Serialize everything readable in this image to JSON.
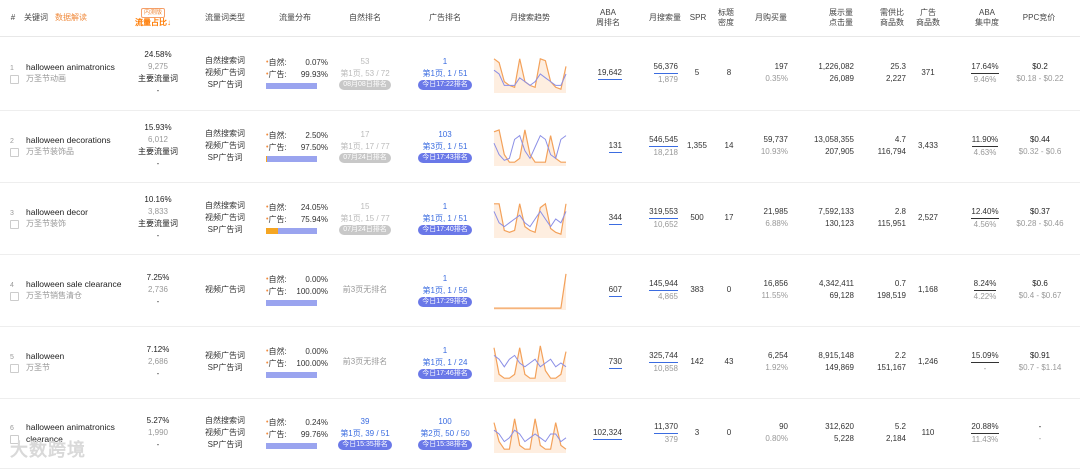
{
  "header": {
    "num": "#",
    "keyword": "关键词",
    "data_export": "数据解读",
    "badge_new": "内测版",
    "flow_share": "流量占比",
    "flow_type": "流量词类型",
    "flow_dist": "流量分布",
    "natural_rank": "自然排名",
    "ad_rank": "广告排名",
    "trend": "月搜索趋势",
    "aba": "ABA\n周排名",
    "monthly_search": "月搜索量",
    "spr": "SPR",
    "title_density": "标题\n密度",
    "monthly_buy": "月购买量",
    "impressions": "展示量\n点击量",
    "supply_demand": "需供比\n商品数",
    "ad_products": "广告\n商品数",
    "aba_concentration": "ABA\n集中度",
    "ppc": "PPC竞价"
  },
  "rows": [
    {
      "idx": "1",
      "kw": "halloween animatronics",
      "kw_cn": "万圣节动画",
      "share": "24.58%",
      "share_sub": "9,275",
      "share_tag": "主要流量词",
      "share_dash": "-",
      "types": [
        "自然搜索词",
        "视频广告词",
        "SP广告词"
      ],
      "nat_label": "自然:",
      "nat_pct": "0.07%",
      "ad_label": "广告:",
      "ad_pct": "99.93%",
      "nat_frac": 0.0007,
      "nat_rank_top": "53",
      "nat_rank_mid": "第1页, 53 / 72",
      "nat_rank_badge": "08月08日排名",
      "ad_rank_top": "1",
      "ad_rank_mid": "第1页, 1 / 51",
      "ad_rank_badge": "今日17:22排名",
      "aba": "19,642",
      "ms": "56,376",
      "ms_sub": "1,879",
      "spr": "5",
      "td": "8",
      "buy": "197",
      "buy_sub": "0.35%",
      "imp": "1,226,082",
      "clk": "26,089",
      "sd": "25.3",
      "prod": "2,227",
      "adp": "371",
      "conc": "17.64%",
      "conc_sub": "9.46%",
      "ppc": "$0.2",
      "ppc_sub": "$0.18 - $0.22"
    },
    {
      "idx": "2",
      "kw": "halloween decorations",
      "kw_cn": "万圣节装饰品",
      "share": "15.93%",
      "share_sub": "6,012",
      "share_tag": "主要流量词",
      "share_dash": "-",
      "types": [
        "自然搜索词",
        "视频广告词",
        "SP广告词"
      ],
      "nat_label": "自然:",
      "nat_pct": "2.50%",
      "ad_label": "广告:",
      "ad_pct": "97.50%",
      "nat_frac": 0.025,
      "nat_rank_top": "17",
      "nat_rank_mid": "第1页, 17 / 77",
      "nat_rank_badge": "07月24日排名",
      "ad_rank_top": "103",
      "ad_rank_mid": "第3页, 1 / 51",
      "ad_rank_badge": "今日17:43排名",
      "aba": "131",
      "ms": "546,545",
      "ms_sub": "18,218",
      "spr": "1,355",
      "td": "14",
      "buy": "59,737",
      "buy_sub": "10.93%",
      "imp": "13,058,355",
      "clk": "207,905",
      "sd": "4.7",
      "prod": "116,794",
      "adp": "3,433",
      "conc": "11.90%",
      "conc_sub": "4.63%",
      "ppc": "$0.44",
      "ppc_sub": "$0.32 - $0.6"
    },
    {
      "idx": "3",
      "kw": "halloween decor",
      "kw_cn": "万圣节装饰",
      "share": "10.16%",
      "share_sub": "3,833",
      "share_tag": "主要流量词",
      "share_dash": "-",
      "types": [
        "自然搜索词",
        "视频广告词",
        "SP广告词"
      ],
      "nat_label": "自然:",
      "nat_pct": "24.05%",
      "ad_label": "广告:",
      "ad_pct": "75.94%",
      "nat_frac": 0.2405,
      "nat_rank_top": "15",
      "nat_rank_mid": "第1页, 15 / 77",
      "nat_rank_badge": "07月24日排名",
      "ad_rank_top": "1",
      "ad_rank_mid": "第1页, 1 / 51",
      "ad_rank_badge": "今日17:40排名",
      "aba": "344",
      "ms": "319,553",
      "ms_sub": "10,652",
      "spr": "500",
      "td": "17",
      "buy": "21,985",
      "buy_sub": "6.88%",
      "imp": "7,592,133",
      "clk": "130,123",
      "sd": "2.8",
      "prod": "115,951",
      "adp": "2,527",
      "conc": "12.40%",
      "conc_sub": "4.56%",
      "ppc": "$0.37",
      "ppc_sub": "$0.28 - $0.46"
    },
    {
      "idx": "4",
      "kw": "halloween sale clearance",
      "kw_cn": "万圣节销售清仓",
      "share": "7.25%",
      "share_sub": "2,736",
      "share_tag": "",
      "share_dash": "-",
      "types": [
        "视频广告词"
      ],
      "nat_label": "自然:",
      "nat_pct": "0.00%",
      "ad_label": "广告:",
      "ad_pct": "100.00%",
      "nat_frac": 0.0,
      "nat_rank_none": "前3页无排名",
      "ad_rank_top": "1",
      "ad_rank_mid": "第1页, 1 / 56",
      "ad_rank_badge": "今日17:29排名",
      "aba": "607",
      "ms": "145,944",
      "ms_sub": "4,865",
      "spr": "383",
      "td": "0",
      "buy": "16,856",
      "buy_sub": "11.55%",
      "imp": "4,342,411",
      "clk": "69,128",
      "sd": "0.7",
      "prod": "198,519",
      "adp": "1,168",
      "conc": "8.24%",
      "conc_sub": "4.22%",
      "ppc": "$0.6",
      "ppc_sub": "$0.4 - $0.67"
    },
    {
      "idx": "5",
      "kw": "halloween",
      "kw_cn": "万圣节",
      "share": "7.12%",
      "share_sub": "2,686",
      "share_tag": "",
      "share_dash": "-",
      "types": [
        "视频广告词",
        "SP广告词"
      ],
      "nat_label": "自然:",
      "nat_pct": "0.00%",
      "ad_label": "广告:",
      "ad_pct": "100.00%",
      "nat_frac": 0.0,
      "nat_rank_none": "前3页无排名",
      "ad_rank_top": "1",
      "ad_rank_mid": "第1页, 1 / 24",
      "ad_rank_badge": "今日17:46排名",
      "aba": "730",
      "ms": "325,744",
      "ms_sub": "10,858",
      "spr": "142",
      "td": "43",
      "buy": "6,254",
      "buy_sub": "1.92%",
      "imp": "8,915,148",
      "clk": "149,869",
      "sd": "2.2",
      "prod": "151,167",
      "adp": "1,246",
      "conc": "15.09%",
      "conc_sub": "-",
      "ppc": "$0.91",
      "ppc_sub": "$0.7 - $1.14"
    },
    {
      "idx": "6",
      "kw": "halloween animatronics clearance",
      "kw_cn": "",
      "share": "5.27%",
      "share_sub": "1,990",
      "share_tag": "",
      "share_dash": "-",
      "types": [
        "自然搜索词",
        "视频广告词",
        "SP广告词"
      ],
      "nat_label": "自然:",
      "nat_pct": "0.24%",
      "ad_label": "广告:",
      "ad_pct": "99.76%",
      "nat_frac": 0.0024,
      "nat_rank_top": "39",
      "nat_rank_mid": "第1页, 39 / 51",
      "nat_rank_badge": "今日15:35排名",
      "ad_rank_top": "100",
      "ad_rank_mid": "第2页, 50 / 50",
      "ad_rank_badge": "今日15:38排名",
      "aba": "102,324",
      "ms": "11,370",
      "ms_sub": "379",
      "spr": "3",
      "td": "0",
      "buy": "90",
      "buy_sub": "0.80%",
      "imp": "312,620",
      "clk": "5,228",
      "sd": "5.2",
      "prod": "2,184",
      "adp": "110",
      "conc": "20.88%",
      "conc_sub": "11.43%",
      "ppc": "-",
      "ppc_sub": "-"
    }
  ],
  "watermark": "大数跨境",
  "colors": {
    "natural": "#f5a623",
    "ad": "#9aa4ef",
    "badge_blue": "#6a78e8",
    "badge_gray": "#c8c8c8",
    "trend_orange": "#f3a15a",
    "trend_purple": "#8b8fe6"
  }
}
